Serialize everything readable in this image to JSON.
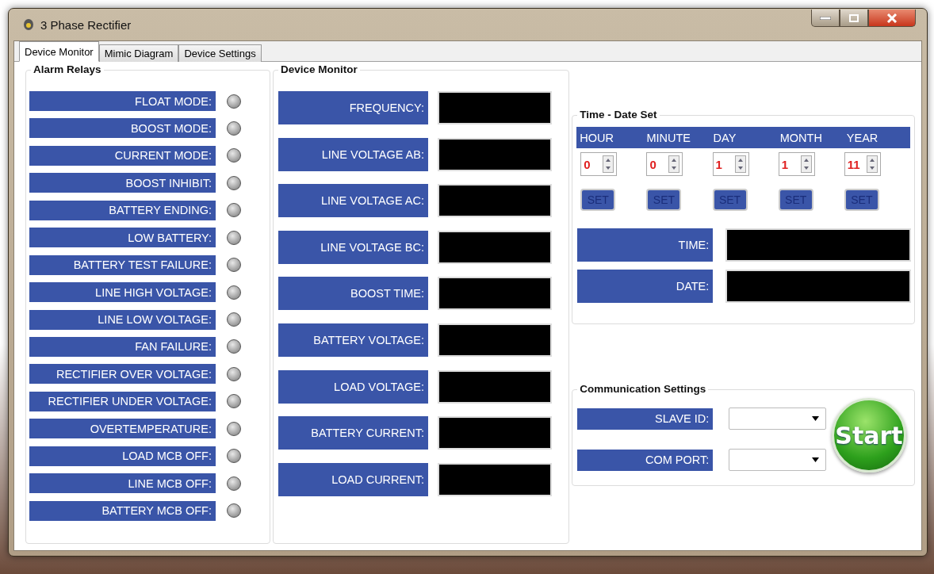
{
  "window": {
    "title": "3 Phase Rectifier"
  },
  "tabs": [
    {
      "label": "Device Monitor",
      "selected": true
    },
    {
      "label": "Mimic Diagram",
      "selected": false
    },
    {
      "label": "Device Settings",
      "selected": false
    }
  ],
  "alarm_relays": {
    "title": "Alarm Relays",
    "items": [
      {
        "label": "FLOAT MODE:",
        "on": false
      },
      {
        "label": "BOOST MODE:",
        "on": false
      },
      {
        "label": "CURRENT MODE:",
        "on": false
      },
      {
        "label": "BOOST INHIBIT:",
        "on": false
      },
      {
        "label": "BATTERY ENDING:",
        "on": false
      },
      {
        "label": "LOW BATTERY:",
        "on": false
      },
      {
        "label": "BATTERY TEST FAILURE:",
        "on": false
      },
      {
        "label": "LINE HIGH VOLTAGE:",
        "on": false
      },
      {
        "label": "LINE LOW VOLTAGE:",
        "on": false
      },
      {
        "label": "FAN FAILURE:",
        "on": false
      },
      {
        "label": "RECTIFIER OVER VOLTAGE:",
        "on": false
      },
      {
        "label": "RECTIFIER UNDER VOLTAGE:",
        "on": false
      },
      {
        "label": "OVERTEMPERATURE:",
        "on": false
      },
      {
        "label": "LOAD MCB OFF:",
        "on": false
      },
      {
        "label": "LINE MCB OFF:",
        "on": false
      },
      {
        "label": "BATTERY MCB OFF:",
        "on": false
      }
    ]
  },
  "device_monitor": {
    "title": "Device Monitor",
    "items": [
      {
        "label": "FREQUENCY:"
      },
      {
        "label": "LINE VOLTAGE AB:"
      },
      {
        "label": "LINE VOLTAGE AC:"
      },
      {
        "label": "LINE VOLTAGE BC:"
      },
      {
        "label": "BOOST TIME:"
      },
      {
        "label": "BATTERY VOLTAGE:"
      },
      {
        "label": "LOAD VOLTAGE:"
      },
      {
        "label": "BATTERY CURRENT:"
      },
      {
        "label": "LOAD CURRENT:"
      }
    ]
  },
  "time_date_set": {
    "title": "Time - Date Set",
    "fields": [
      {
        "label": "HOUR",
        "value": "0",
        "button": "SET"
      },
      {
        "label": "MINUTE",
        "value": "0",
        "button": "SET"
      },
      {
        "label": "DAY",
        "value": "1",
        "button": "SET"
      },
      {
        "label": "MONTH",
        "value": "1",
        "button": "SET"
      },
      {
        "label": "YEAR",
        "value": "11",
        "button": "SET"
      }
    ],
    "displays": [
      {
        "label": "TIME:"
      },
      {
        "label": "DATE:"
      }
    ]
  },
  "communication_settings": {
    "title": "Communication Settings",
    "fields": [
      {
        "label": "SLAVE ID:"
      },
      {
        "label": "COM PORT:"
      }
    ],
    "start_button": "Start"
  }
}
